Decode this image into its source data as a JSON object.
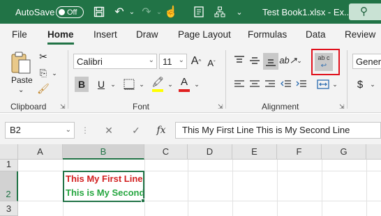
{
  "titlebar": {
    "autosave_label": "AutoSave",
    "autosave_state": "Off",
    "doc_title": "Test Book1.xlsx - Ex...",
    "icons": [
      "save-icon",
      "undo-icon",
      "redo-icon",
      "touch-mode-icon",
      "form-icon",
      "org-chart-icon",
      "search-icon"
    ]
  },
  "tabs": [
    {
      "label": "File"
    },
    {
      "label": "Home",
      "active": true
    },
    {
      "label": "Insert"
    },
    {
      "label": "Draw"
    },
    {
      "label": "Page Layout"
    },
    {
      "label": "Formulas"
    },
    {
      "label": "Data"
    },
    {
      "label": "Review"
    }
  ],
  "ribbon": {
    "clipboard": {
      "label": "Clipboard",
      "paste_label": "Paste"
    },
    "font": {
      "label": "Font",
      "font_name": "Calibri",
      "font_size": "11",
      "bold": "B",
      "underline": "U"
    },
    "alignment": {
      "label": "Alignment",
      "wrap_text_glyph": "ab c",
      "wrap_highlighted": true
    },
    "number": {
      "format": "Genera",
      "currency": "$"
    }
  },
  "colors": {
    "accent": "#217346",
    "highlight_box": "#e0101c",
    "fill_color": "#ffff00",
    "font_color": "#e02020"
  },
  "formula_bar": {
    "name_box": "B2",
    "fx_label": "fx",
    "content": "This My First Line This is My Second Line"
  },
  "grid": {
    "columns": [
      "A",
      "B",
      "C",
      "D",
      "E",
      "F",
      "G"
    ],
    "rows": [
      "1",
      "2",
      "3"
    ],
    "selected_column": "B",
    "selected_row": "2",
    "cell_b2": {
      "line1": "This My First Line",
      "line1_color": "#d21f1f",
      "line2": "This is My Second Line",
      "line2_color": "#26a640"
    }
  }
}
